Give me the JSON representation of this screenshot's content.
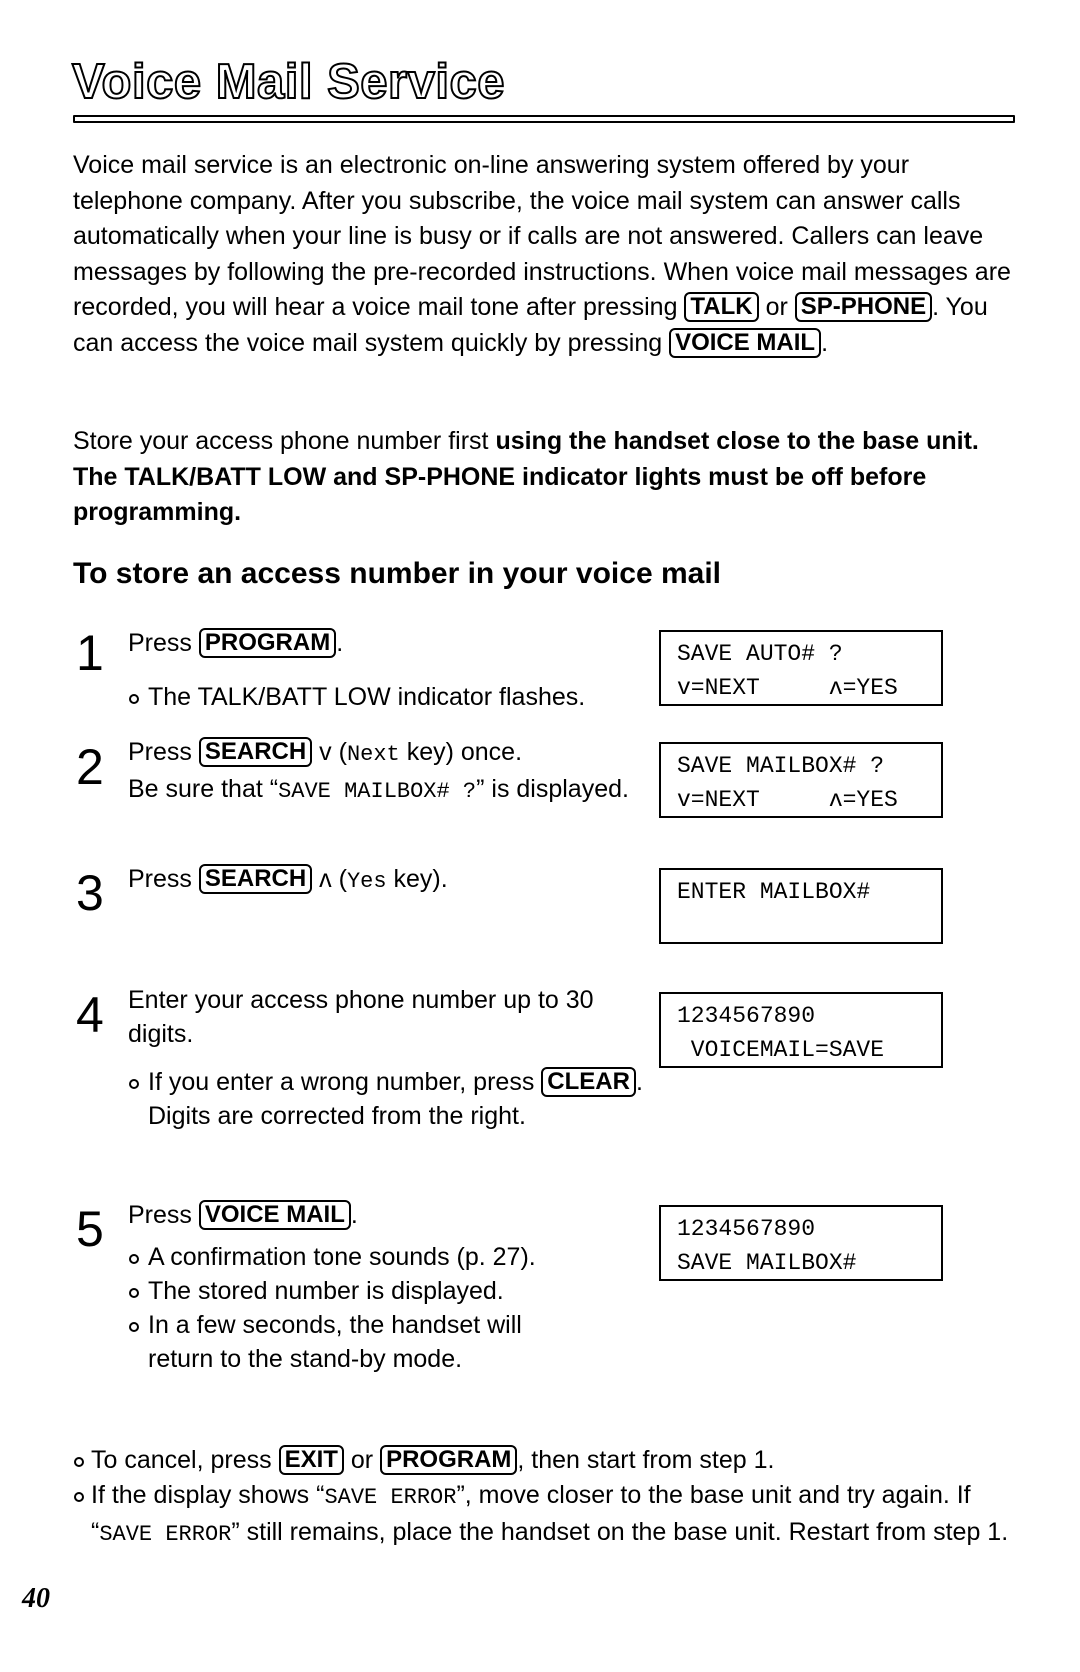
{
  "header": {
    "title": "Voice Mail Service"
  },
  "intro": {
    "p1_part1": "Voice mail service is an electronic on-line answering system offered by your telephone company. After you subscribe, the voice mail system can answer calls automatically when your line is busy or if calls are not answered. Callers can leave messages by following the pre-recorded instructions. When voice mail messages are recorded, you will hear a voice mail tone after pressing ",
    "key_talk": "TALK",
    "p1_or": " or ",
    "key_sp_phone": "SP-PHONE",
    "p1_part2": ". You can access the voice mail system quickly by pressing ",
    "key_voice_mail": "VOICE MAIL",
    "p1_end": ".",
    "p2_normal": "Store your access phone number first ",
    "p2_bold": "using the handset close to the base unit. The TALK/BATT LOW and SP-PHONE indicator lights must be off before programming."
  },
  "section": {
    "heading": "To store an access number in your voice mail"
  },
  "steps": [
    {
      "number": "1",
      "press": "Press ",
      "key": "PROGRAM",
      "end": ".",
      "bullet": "The TALK/BATT LOW indicator flashes.",
      "display": {
        "line1": "SAVE AUTO# ?",
        "line2": "v=NEXT     ʌ=YES"
      }
    },
    {
      "number": "2",
      "press": "Press ",
      "key": "SEARCH",
      "arrow": " v ",
      "paren_open": "(",
      "mono": "Next",
      "after": " key) once.",
      "line2_pre": "Be sure that “",
      "line2_mono": "SAVE MAILBOX# ?",
      "line2_post": "” is displayed.",
      "display": {
        "line1": "SAVE MAILBOX# ?",
        "line2": "v=NEXT     ʌ=YES"
      }
    },
    {
      "number": "3",
      "press": "Press ",
      "key": "SEARCH",
      "arrow": " ʌ ",
      "paren_open": "(",
      "mono": "Yes",
      "after": " key).",
      "display": {
        "line1": "ENTER MAILBOX#",
        "line2": ""
      }
    },
    {
      "number": "4",
      "text": "Enter your access phone number up to 30 digits.",
      "bullet_pre": "If you enter a wrong number, press ",
      "key": "CLEAR",
      "bullet_post": ". Digits are corrected from the right.",
      "display": {
        "line1": "1234567890",
        "line2": " VOICEMAIL=SAVE"
      }
    },
    {
      "number": "5",
      "press": "Press ",
      "key": "VOICE MAIL",
      "end": ".",
      "bullets": [
        "A confirmation tone sounds (p. 27).",
        "The stored number is displayed.",
        "In a few seconds, the handset will return to the stand-by mode."
      ],
      "display": {
        "line1": "1234567890",
        "line2": "SAVE MAILBOX#"
      }
    }
  ],
  "notes": {
    "n1_pre": "To cancel, press ",
    "n1_key1": "EXIT",
    "n1_or": " or ",
    "n1_key2": "PROGRAM",
    "n1_post": ", then start from step 1.",
    "n2_pre": "If the display shows “",
    "n2_mono1": "SAVE ERROR",
    "n2_mid": "”, move closer to the base unit and try again. If “",
    "n2_mono2": "SAVE ERROR",
    "n2_post": "” still remains, place the handset on the base unit. Restart from step 1."
  },
  "footer": {
    "page_number": "40"
  }
}
